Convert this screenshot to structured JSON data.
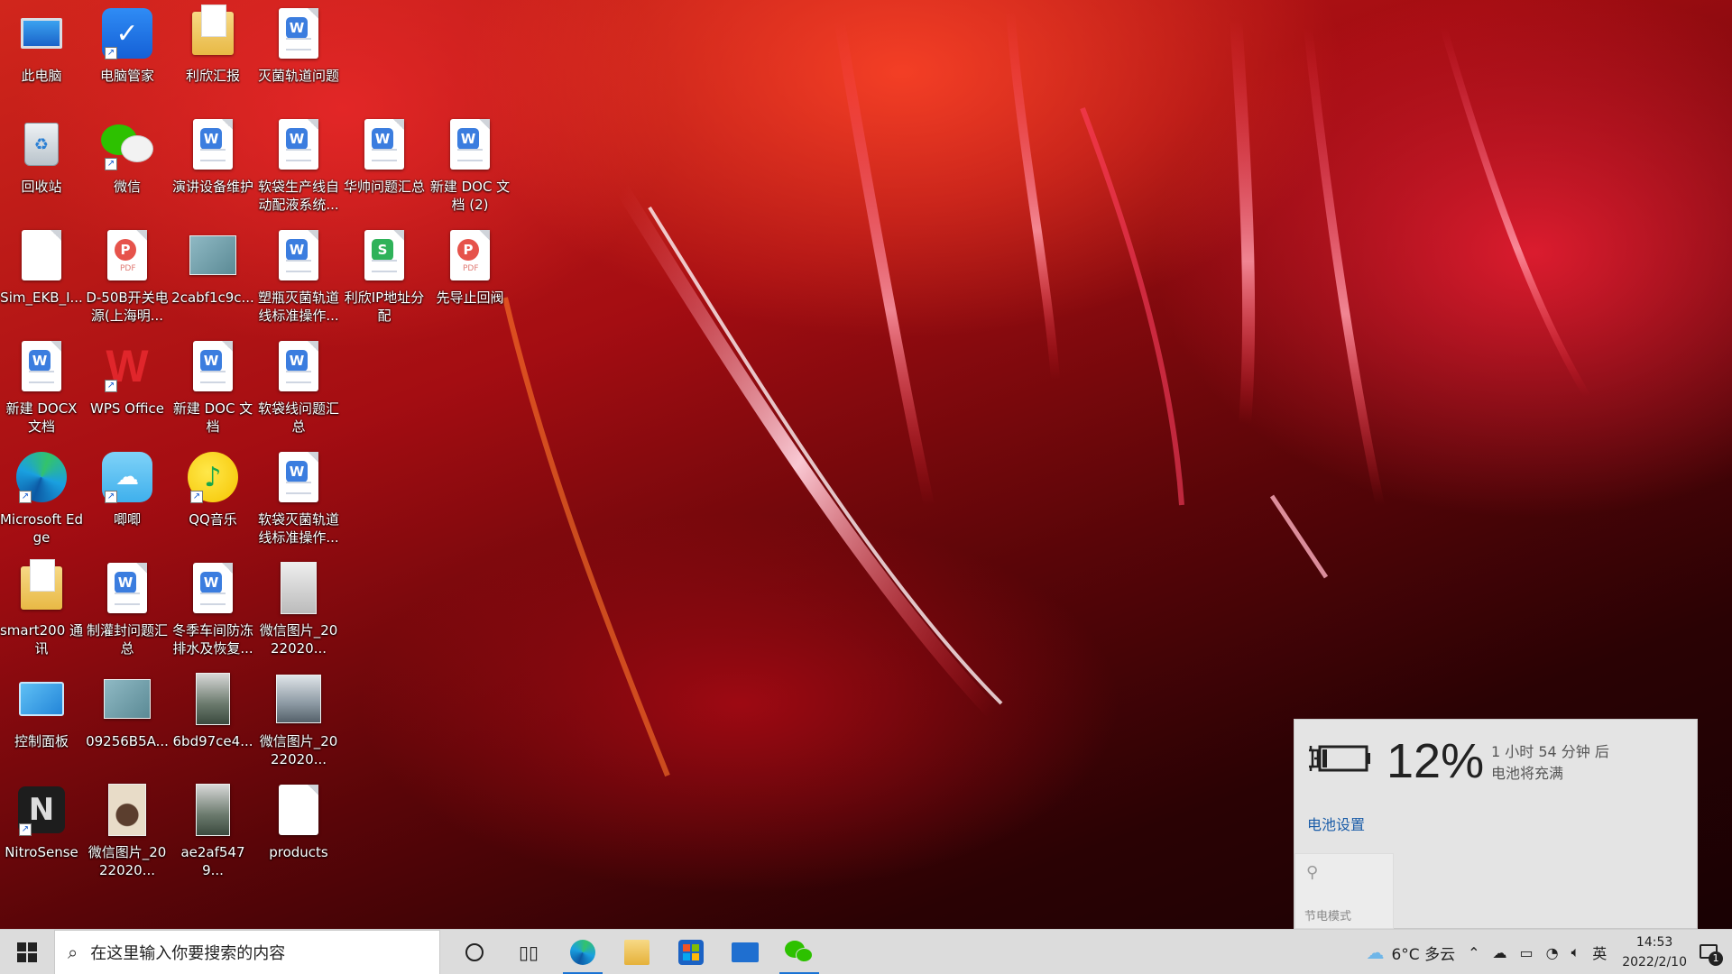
{
  "desktop": {
    "icons": {
      "this_pc": "此电脑",
      "pc_manager": "电脑管家",
      "lixin_report": "利欣汇报",
      "sterilize_issue": "灭菌轨道问题",
      "recycle_bin": "回收站",
      "wechat": "微信",
      "speech_equipment": "演讲设备维护",
      "softbag_line": "软袋生产线自动配液系统...",
      "huashuai": "华帅问题汇总",
      "new_doc2": "新建 DOC 文档 (2)",
      "sim_ekb": "Sim_EKB_I...",
      "d50b": "D-50B开关电源(上海明...",
      "file_2cabf": "2cabf1c9c...",
      "bottle_line": "塑瓶灭菌轨道线标准操作...",
      "lixin_ip": "利欣IP地址分配",
      "pilot_valve": "先导止回阀",
      "new_docx": "新建 DOCX 文档",
      "wps_office": "WPS Office",
      "new_doc": "新建 DOC 文档",
      "softbag_issue": "软袋线问题汇总",
      "edge": "Microsoft Edge",
      "jiji": "唧唧",
      "qq_music": "QQ音乐",
      "softbag_sterilize": "软袋灭菌轨道线标准操作...",
      "smart200": "smart200 通讯",
      "seal_issue": "制灌封问题汇总",
      "winter_workshop": "冬季车间防冻排水及恢复...",
      "wechat_img1": "微信图片_2022020...",
      "control_panel": "控制面板",
      "file_09256": "09256B5A...",
      "file_6bd97": "6bd97ce4...",
      "wechat_img2": "微信图片_2022020...",
      "nitrosense": "NitroSense",
      "wechat_img3": "微信图片_2022020...",
      "file_ae2af": "ae2af5479...",
      "products": "products"
    }
  },
  "battery_flyout": {
    "percent": "12%",
    "eta_line1": "1 小时 54 分钟 后",
    "eta_line2": "电池将充满",
    "settings_link": "电池设置",
    "saver_label": "节电模式"
  },
  "taskbar": {
    "search_placeholder": "在这里输入你要搜索的内容",
    "weather": "6°C  多云",
    "ime": "英",
    "time": "14:53",
    "date": "2022/2/10",
    "notification_count": "1"
  },
  "colors": {
    "taskbar_bg": "#dcdcdc",
    "accent": "#1973d4",
    "link": "#1a5ca8"
  },
  "icons": [
    "windows-start-icon",
    "search-icon",
    "cortana-icon",
    "task-view-icon",
    "edge-icon",
    "file-explorer-icon",
    "store-icon",
    "mail-icon",
    "wechat-icon",
    "weather-icon",
    "chevron-up-icon",
    "onedrive-icon",
    "battery-icon",
    "wifi-icon",
    "volume-icon",
    "notification-icon"
  ]
}
